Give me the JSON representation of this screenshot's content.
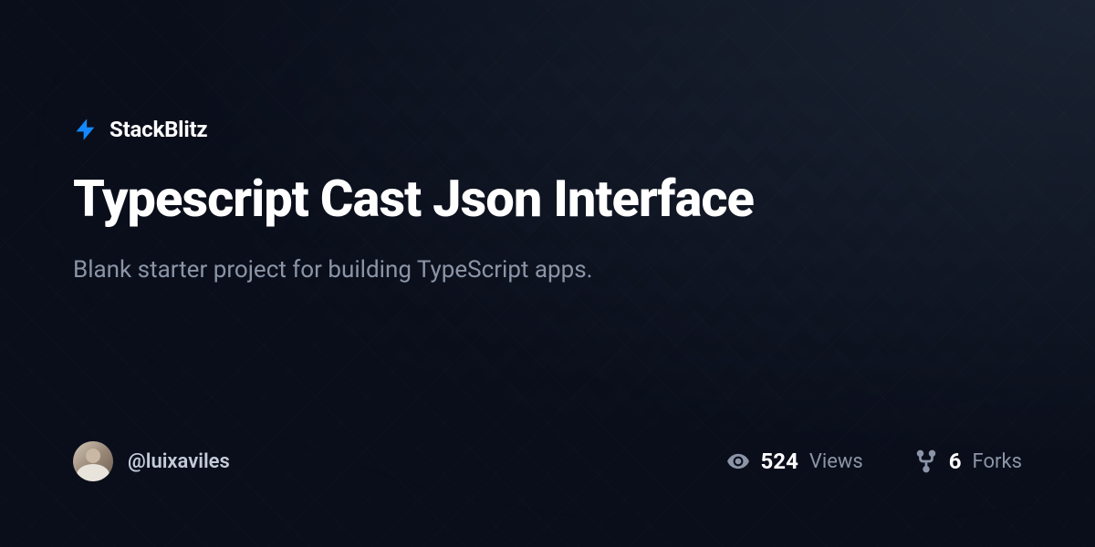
{
  "brand": {
    "name": "StackBlitz"
  },
  "project": {
    "title": "Typescript Cast Json Interface",
    "description": "Blank starter project for building TypeScript apps."
  },
  "author": {
    "username": "@luixaviles"
  },
  "stats": {
    "views": {
      "value": "524",
      "label": "Views"
    },
    "forks": {
      "value": "6",
      "label": "Forks"
    }
  }
}
